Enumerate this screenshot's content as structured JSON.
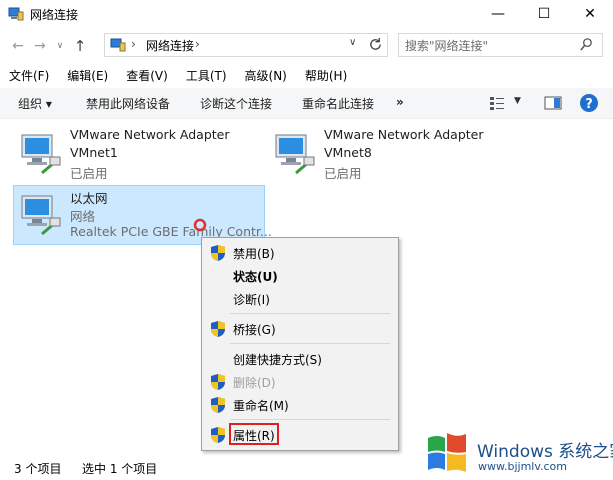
{
  "window": {
    "title": "网络连接",
    "minimize_glyph": "—",
    "maximize_glyph": "☐",
    "close_glyph": "✕"
  },
  "nav": {
    "back_glyph": "←",
    "forward_glyph": "→",
    "dropdown_glyph": "∨",
    "up_glyph": "↑",
    "address": [
      "网络连接"
    ],
    "address_sep": "›",
    "search_placeholder": "搜索\"网络连接\""
  },
  "menubar": [
    "文件(F)",
    "编辑(E)",
    "查看(V)",
    "工具(T)",
    "高级(N)",
    "帮助(H)"
  ],
  "commandbar": {
    "organize": "组织 ▾",
    "disable_device": "禁用此网络设备",
    "diagnose": "诊断这个连接",
    "rename": "重命名此连接",
    "more": "»"
  },
  "adapters": [
    {
      "name": "VMware Network Adapter",
      "sub": "VMnet1",
      "status": "已启用"
    },
    {
      "name": "VMware Network Adapter",
      "sub": "VMnet8",
      "status": "已启用"
    },
    {
      "name": "以太网",
      "sub": "网络",
      "status": "Realtek PCIe GBE Family Contr..."
    }
  ],
  "context_menu": [
    {
      "label": "禁用(B)",
      "shield": true
    },
    {
      "label": "状态(U)",
      "bold": true
    },
    {
      "label": "诊断(I)"
    },
    {
      "label": "桥接(G)",
      "shield": true
    },
    {
      "label": "创建快捷方式(S)"
    },
    {
      "label": "删除(D)",
      "shield": true,
      "disabled": true
    },
    {
      "label": "重命名(M)",
      "shield": true
    },
    {
      "label": "属性(R)",
      "shield": true,
      "highlighted": true
    }
  ],
  "status": {
    "count": "3 个项目",
    "selected": "选中 1 个项目"
  },
  "watermark": {
    "brand": "Windows 系统之家",
    "url": "www.bjjmlv.com"
  },
  "colors": {
    "selection": "#cce8ff",
    "highlight_border": "#e02020",
    "watermark": "#1c4f8a"
  }
}
